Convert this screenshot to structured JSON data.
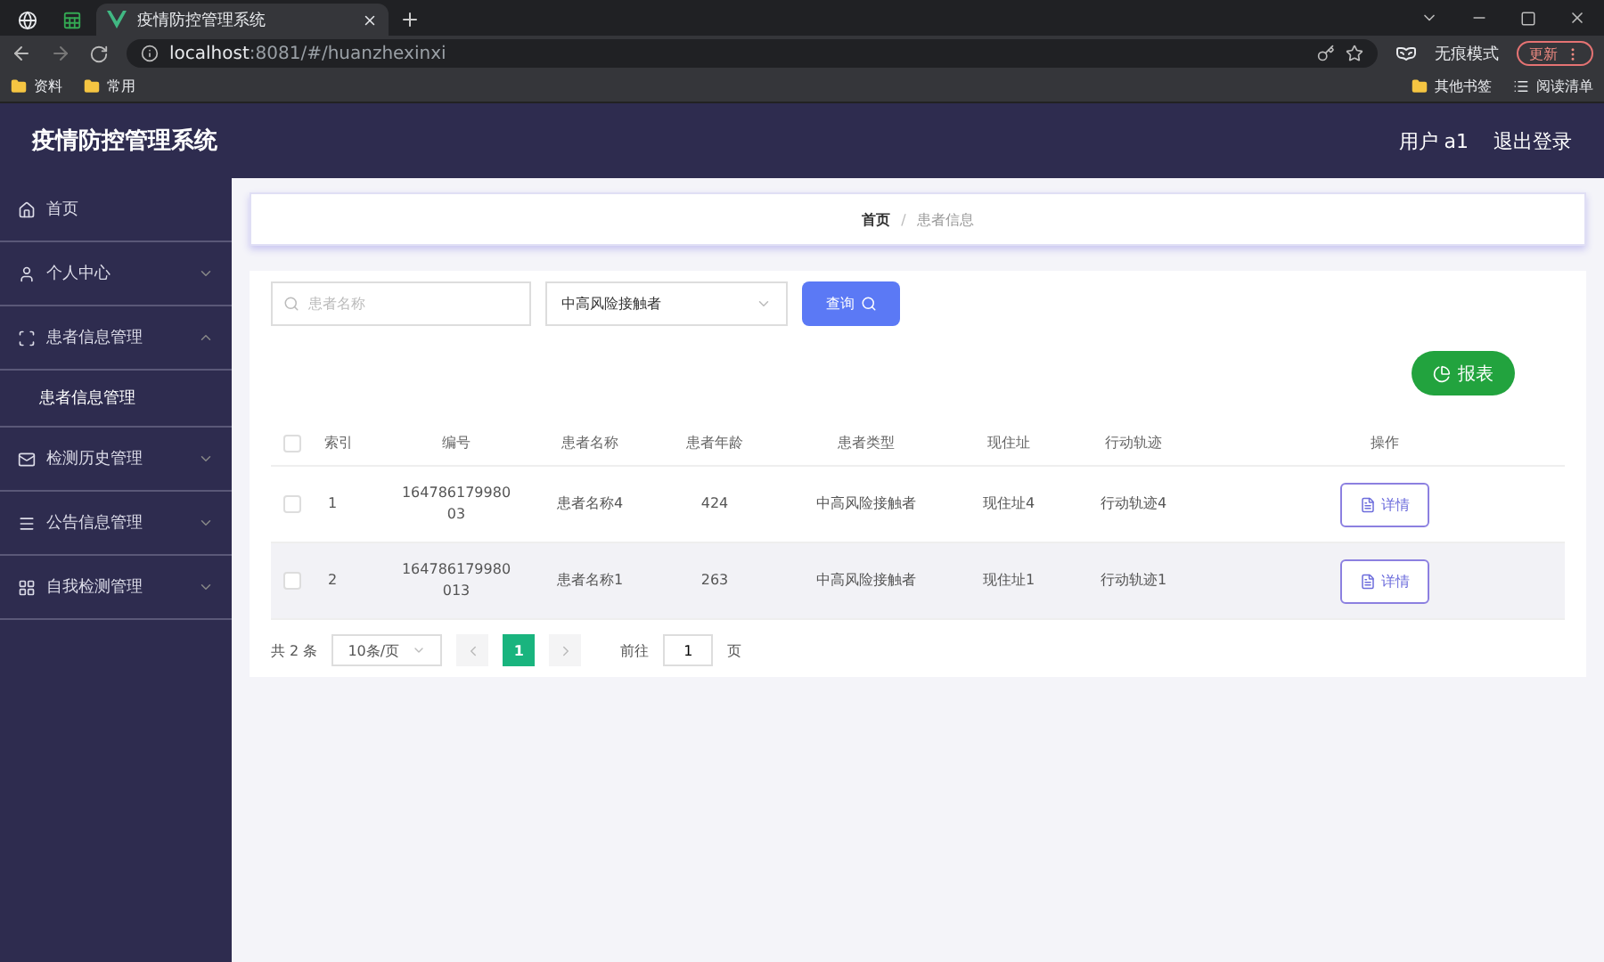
{
  "browser": {
    "tabs": [
      {
        "kind": "globe",
        "selected": false
      },
      {
        "kind": "sheet",
        "selected": false
      },
      {
        "kind": "vue",
        "title": "疫情防控管理系统",
        "selected": true
      }
    ],
    "url_host": "localhost",
    "url_rest": ":8081/#/huanzhexinxi",
    "incognito": "无痕模式",
    "update": "更新",
    "bookmarks_left": [
      "资料",
      "常用"
    ],
    "bookmarks_right": [
      {
        "kind": "folder",
        "label": "其他书签"
      },
      {
        "kind": "list",
        "label": "阅读清单"
      }
    ]
  },
  "header": {
    "title": "疫情防控管理系统",
    "user": "用户 a1",
    "logout": "退出登录"
  },
  "sidebar": {
    "items": [
      {
        "kind": "link",
        "label": "首页"
      },
      {
        "kind": "group",
        "label": "个人中心",
        "expanded": false
      },
      {
        "kind": "group",
        "label": "患者信息管理",
        "expanded": true,
        "children": [
          {
            "label": "患者信息管理"
          }
        ]
      },
      {
        "kind": "group",
        "label": "检测历史管理",
        "expanded": false
      },
      {
        "kind": "group",
        "label": "公告信息管理",
        "expanded": false
      },
      {
        "kind": "group",
        "label": "自我检测管理",
        "expanded": false
      }
    ]
  },
  "breadcrumb": {
    "separator": "/",
    "items": [
      "首页",
      "患者信息"
    ]
  },
  "search": {
    "placeholder": "患者名称",
    "select_value": "中高风险接触者",
    "query": "查询"
  },
  "report": "报表",
  "table": {
    "all_checked": false,
    "columns": [
      "索引",
      "编号",
      "患者名称",
      "患者年龄",
      "患者类型",
      "现住址",
      "行动轨迹",
      "操作"
    ],
    "rows": [
      {
        "checked": false,
        "highlighted": false,
        "cells": [
          "1",
          "16478617998003",
          "患者名称4",
          "424",
          "中高风险接触者",
          "现住址4",
          "行动轨迹4"
        ],
        "action": "详情"
      },
      {
        "checked": false,
        "highlighted": true,
        "cells": [
          "2",
          "164786179980013",
          "患者名称1",
          "263",
          "中高风险接触者",
          "现住址1",
          "行动轨迹1"
        ],
        "action": "详情"
      }
    ]
  },
  "pagination": {
    "total": "共 2 条",
    "size": "10条/页",
    "pages": [
      {
        "label": "1",
        "selected": true
      }
    ],
    "goto": "前往",
    "goto_value": "1",
    "suffix": "页"
  }
}
